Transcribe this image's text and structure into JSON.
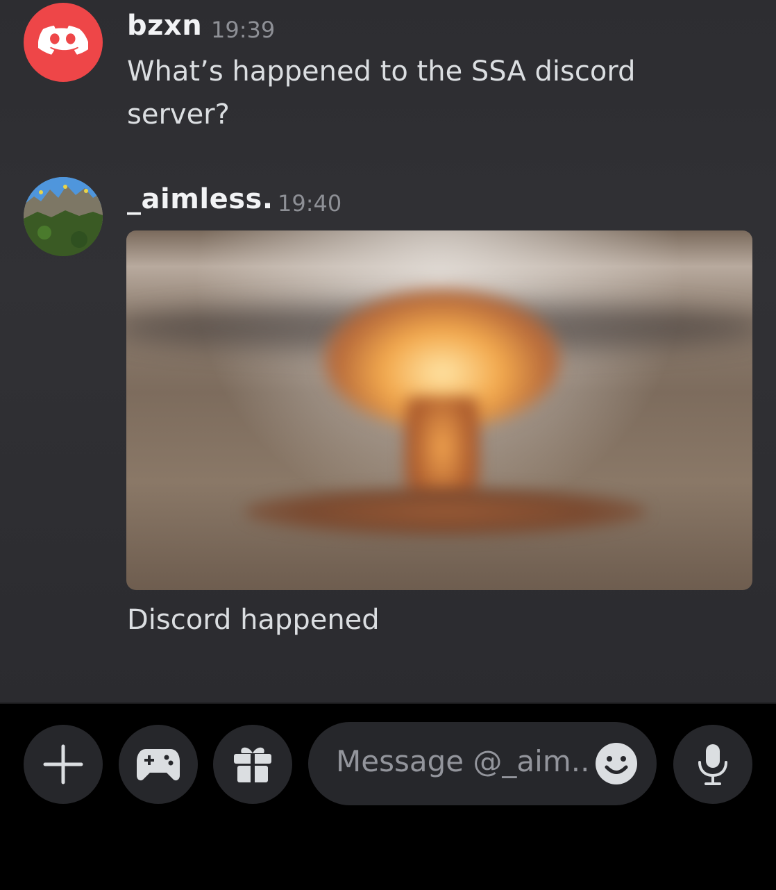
{
  "messages": [
    {
      "author": "bzxn",
      "time": "19:39",
      "text_line1": "What’s happened to the SSA discord",
      "text_line2": "server?",
      "avatar_icon": "discord-logo-icon"
    },
    {
      "author": "_aimless.",
      "time": "19:40",
      "attachment": "mushroom-cloud-explosion-image",
      "text": "Discord happened",
      "avatar_icon": "landscape-avatar"
    }
  ],
  "composer": {
    "placeholder": "Message @_aim..",
    "buttons": [
      "plus-icon",
      "gamepad-icon",
      "gift-icon",
      "emoji-icon",
      "microphone-icon"
    ]
  },
  "colors": {
    "background": "#2d2d31",
    "discord_red": "#ee4648",
    "button_bg": "#26272b",
    "text": "#dbdee1",
    "muted": "#8e9096"
  }
}
